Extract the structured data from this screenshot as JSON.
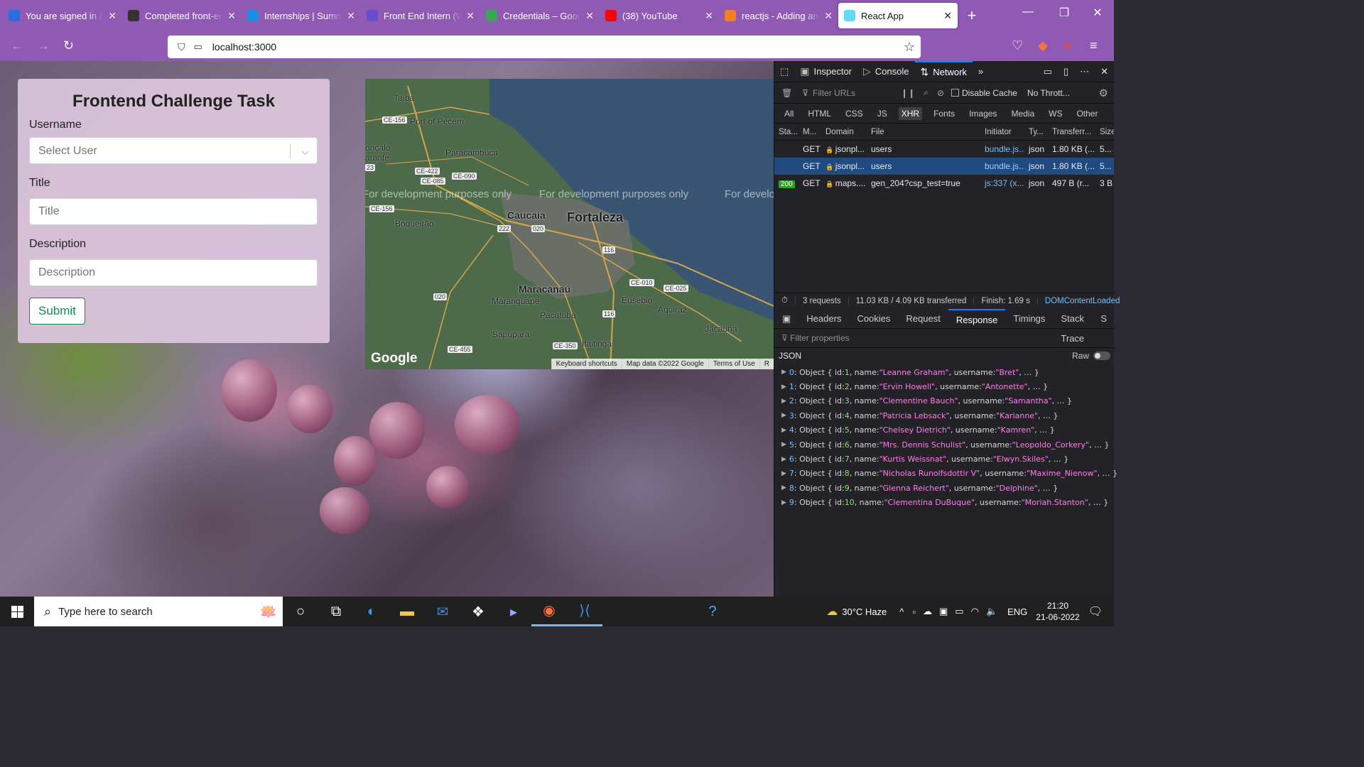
{
  "browser": {
    "tabs": [
      {
        "title": "You are signed in as",
        "favicon": "slack-s-icon",
        "color": "#2a6de0",
        "active": false
      },
      {
        "title": "Completed front-end",
        "favicon": "github-icon",
        "color": "#333333",
        "active": false
      },
      {
        "title": "Internships | Summer",
        "favicon": "internshala-icon",
        "color": "#1a8de0",
        "active": false
      },
      {
        "title": "Front End Intern (WF",
        "favicon": "doc-icon",
        "color": "#6a4cd0",
        "active": false
      },
      {
        "title": "Credentials – Google",
        "favicon": "google-cloud-icon",
        "color": "#34a853",
        "active": false
      },
      {
        "title": "(38) YouTube",
        "favicon": "youtube-icon",
        "color": "#ff0000",
        "active": false
      },
      {
        "title": "reactjs - Adding an",
        "favicon": "stackoverflow-icon",
        "color": "#f48024",
        "active": false
      },
      {
        "title": "React App",
        "favicon": "react-icon",
        "color": "#61dafb",
        "active": true
      }
    ],
    "url": "localhost:3000"
  },
  "form": {
    "title": "Frontend Challenge Task",
    "username_label": "Username",
    "username_placeholder": "Select User",
    "title_label": "Title",
    "title_placeholder": "Title",
    "description_label": "Description",
    "description_placeholder": "Description",
    "submit_label": "Submit"
  },
  "map": {
    "dev_watermark": "For development purposes only",
    "cities": [
      {
        "name": "Fortaleza",
        "major": true
      },
      {
        "name": "Caucaia",
        "major": false
      },
      {
        "name": "Maracanaú",
        "major": false
      }
    ],
    "places": [
      "Taíba",
      "Port of Pecem",
      "Paracambuca",
      "Boqueirão",
      "Maranguape",
      "Pacatuba",
      "Eusébio",
      "Aquiraz",
      "Sapupara",
      "Itaitinga",
      "Jacaúna",
      "onçalo",
      "arante"
    ],
    "roads": [
      "CE-156",
      "CE-422",
      "CE-085",
      "CE-090",
      "CE-156",
      "222",
      "020",
      "116",
      "CE-010",
      "CE-025",
      "020",
      "116",
      "CE-455",
      "CE-350",
      "23"
    ],
    "logo": "Google",
    "footer": [
      "Keyboard shortcuts",
      "Map data ©2022 Google",
      "Terms of Use",
      "R"
    ]
  },
  "devtools": {
    "tabs": [
      "Inspector",
      "Console",
      "Network"
    ],
    "active_tab": "Network",
    "filter_placeholder": "Filter URLs",
    "disable_cache": "Disable Cache",
    "throttle": "No Thrott...",
    "types": [
      "All",
      "HTML",
      "CSS",
      "JS",
      "XHR",
      "Fonts",
      "Images",
      "Media",
      "WS",
      "Other"
    ],
    "active_type": "XHR",
    "columns": [
      "Sta...",
      "M...",
      "Domain",
      "File",
      "Initiator",
      "Ty...",
      "Transferr...",
      "Size"
    ],
    "requests": [
      {
        "status": "",
        "method": "GET",
        "domain": "jsonpl...",
        "file": "users",
        "initiator": "bundle.js...",
        "type": "json",
        "transferred": "1.80 KB (...",
        "size": "5...",
        "selected": false
      },
      {
        "status": "",
        "method": "GET",
        "domain": "jsonpl...",
        "file": "users",
        "initiator": "bundle.js...",
        "type": "json",
        "transferred": "1.80 KB (...",
        "size": "5...",
        "selected": true
      },
      {
        "status": "200",
        "method": "GET",
        "domain": "maps....",
        "file": "gen_204?csp_test=true",
        "initiator": "js:337 (x...",
        "type": "json",
        "transferred": "497 B (r...",
        "size": "3 B",
        "selected": false
      }
    ],
    "summary": {
      "requests": "3 requests",
      "transferred": "11.03 KB / 4.09 KB transferred",
      "finish": "Finish: 1.69 s",
      "dcl": "DOMContentLoaded"
    },
    "detail_tabs": [
      "Headers",
      "Cookies",
      "Request",
      "Response",
      "Timings",
      "Stack Trace",
      "S"
    ],
    "active_detail_tab": "Response",
    "filter_properties": "Filter properties",
    "json_label": "JSON",
    "raw_label": "Raw",
    "json_rows": [
      {
        "index": "0",
        "id": "1",
        "name": "\"Leanne Graham\"",
        "username": "\"Bret\""
      },
      {
        "index": "1",
        "id": "2",
        "name": "\"Ervin Howell\"",
        "username": "\"Antonette\""
      },
      {
        "index": "2",
        "id": "3",
        "name": "\"Clementine Bauch\"",
        "username": "\"Samantha\""
      },
      {
        "index": "3",
        "id": "4",
        "name": "\"Patricia Lebsack\"",
        "username": "\"Karianne\""
      },
      {
        "index": "4",
        "id": "5",
        "name": "\"Chelsey Dietrich\"",
        "username": "\"Kamren\""
      },
      {
        "index": "5",
        "id": "6",
        "name": "\"Mrs. Dennis Schulist\"",
        "username": "\"Leopoldo_Corkery\""
      },
      {
        "index": "6",
        "id": "7",
        "name": "\"Kurtis Weissnat\"",
        "username": "\"Elwyn.Skiles\""
      },
      {
        "index": "7",
        "id": "8",
        "name": "\"Nicholas Runolfsdottir V\"",
        "username": "\"Maxime_Nienow\""
      },
      {
        "index": "8",
        "id": "9",
        "name": "\"Glenna Reichert\"",
        "username": "\"Delphine\""
      },
      {
        "index": "9",
        "id": "10",
        "name": "\"Clementina DuBuque\"",
        "username": "\"Moriah.Stanton\""
      }
    ]
  },
  "taskbar": {
    "search_placeholder": "Type here to search",
    "weather": "30°C Haze",
    "language": "ENG",
    "time": "21:20",
    "date": "21-06-2022"
  }
}
